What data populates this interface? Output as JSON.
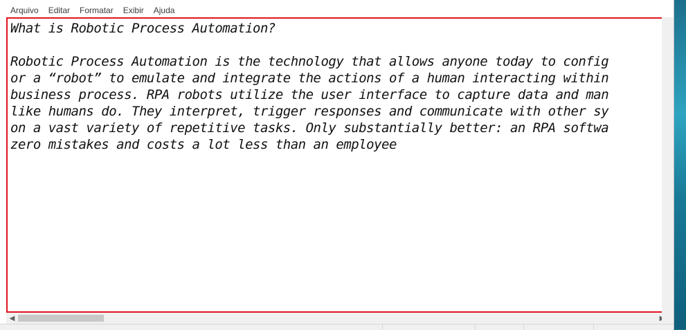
{
  "menu": {
    "file": "Arquivo",
    "edit": "Editar",
    "format": "Formatar",
    "view": "Exibir",
    "help": "Ajuda"
  },
  "document": {
    "lines": [
      "What is Robotic Process Automation?",
      "",
      "Robotic Process Automation is the technology that allows anyone today to config",
      "or a “robot” to emulate and integrate the actions of a human interacting within",
      "business process. RPA robots utilize the user interface to capture data and man",
      "like humans do. They interpret, trigger responses and communicate with other sy",
      "on a vast variety of repetitive tasks. Only substantially better: an RPA softwa",
      "zero mistakes and costs a lot less than an employee"
    ]
  },
  "scrollbar": {
    "left_arrow": "◀",
    "right_arrow": "▶"
  },
  "colors": {
    "editor_border": "#e0141e",
    "window_bg": "#ffffff",
    "desktop": "#1f7c98"
  }
}
